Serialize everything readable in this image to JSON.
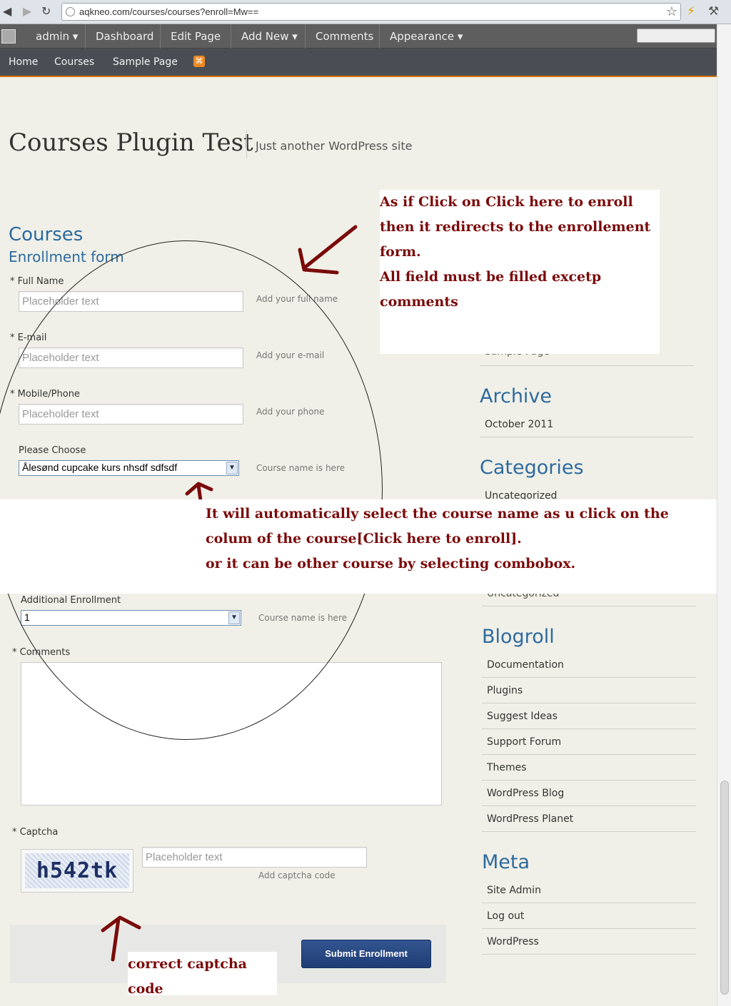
{
  "browser": {
    "url": "aqkneo.com/courses/courses?enroll=Mw=="
  },
  "adminbar": {
    "items": [
      "admin ▾",
      "Dashboard",
      "Edit Page",
      "Add New ▾",
      "Comments",
      "Appearance ▾"
    ]
  },
  "sitenav": {
    "links": [
      "Home",
      "Courses",
      "Sample Page"
    ]
  },
  "header": {
    "title": "Courses Plugin Test",
    "tagline": "Just another WordPress site"
  },
  "content": {
    "heading": "Courses",
    "subheading": "Enrollment form",
    "full_name": {
      "label": "* Full Name",
      "placeholder": "Placeholder text",
      "hint": "Add your full name"
    },
    "email": {
      "label": "* E-mail",
      "placeholder": "Placeholder text",
      "hint": "Add your e-mail"
    },
    "phone": {
      "label": "* Mobile/Phone",
      "placeholder": "Placeholder text",
      "hint": "Add your phone"
    },
    "course": {
      "label": "Please Choose",
      "selected": "Ålesønd cupcake kurs nhsdf sdfsdf",
      "hint": "Course name is here"
    },
    "additional": {
      "label": "Additional Enrollment",
      "selected": "1",
      "hint": "Course name is here"
    },
    "comments": {
      "label": "* Comments"
    },
    "captcha": {
      "label": "* Captcha",
      "image_text": "h542tk",
      "placeholder": "Placeholder text",
      "hint": "Add captcha code"
    },
    "submit_label": "Submit Enrollment"
  },
  "sidebar": {
    "cut_item_1": "Sample Page",
    "archive": {
      "heading": "Archive",
      "items": [
        "October 2011"
      ]
    },
    "categories": {
      "heading": "Categories",
      "items": [
        "Uncategorized"
      ],
      "cut_item": "Uncategorized"
    },
    "blogroll": {
      "heading": "Blogroll",
      "items": [
        "Documentation",
        "Plugins",
        "Suggest Ideas",
        "Support Forum",
        "Themes",
        "WordPress Blog",
        "WordPress Planet"
      ]
    },
    "meta": {
      "heading": "Meta",
      "items": [
        "Site Admin",
        "Log out",
        "WordPress"
      ]
    }
  },
  "annotations": {
    "top_right": [
      "As if Click on Click here to enroll",
      "then it redirects to the enrollement",
      "form.",
      "All field must be filled excetp",
      "comments"
    ],
    "middle": [
      "It will automatically select the course name as u click on the",
      "colum of the course[Click here to enroll].",
      "or it can be other course by selecting combobox."
    ],
    "bottom": "correct captcha code"
  },
  "colors": {
    "annotation_text": "#7a0a0a",
    "heading_blue": "#2e6a9e",
    "admin_bar": "#5e5e5e",
    "nav_bar": "#4a4e54",
    "nav_accent": "#d6730a",
    "submit_button": "#1f3c75"
  },
  "icons": [
    "back-icon",
    "forward-icon",
    "reload-icon",
    "bookmark-star-icon",
    "extension-icon",
    "wrench-icon",
    "rss-icon",
    "dropdown-arrow-icon"
  ]
}
